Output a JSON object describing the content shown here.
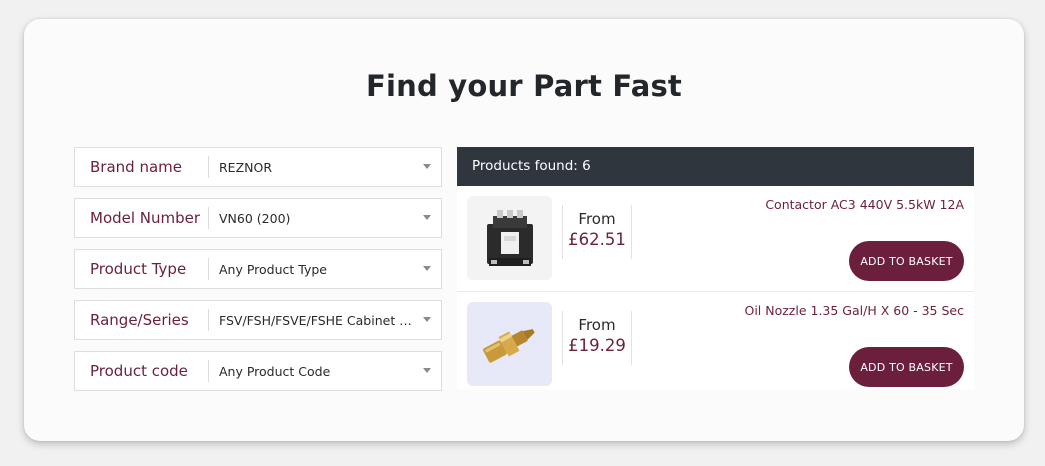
{
  "title": "Find your Part Fast",
  "filters": [
    {
      "label": "Brand name",
      "value": "REZNOR"
    },
    {
      "label": "Model Number",
      "value": "VN60 (200)"
    },
    {
      "label": "Product Type",
      "value": "Any Product Type"
    },
    {
      "label": "Range/Series",
      "value": "FSV/FSH/FSVE/FSHE Cabinet He..."
    },
    {
      "label": "Product code",
      "value": "Any Product Code"
    }
  ],
  "results": {
    "header": "Products found: 6",
    "products": [
      {
        "name": "Contactor AC3 440V 5.5kW 12A",
        "from_label": "From",
        "price": "£62.51",
        "button": "ADD TO BASKET",
        "image": "contactor-image"
      },
      {
        "name": "Oil Nozzle 1.35 Gal/H X 60 - 35 Sec",
        "from_label": "From",
        "price": "£19.29",
        "button": "ADD TO BASKET",
        "image": "oil-nozzle-image"
      }
    ]
  },
  "colors": {
    "brand": "#6b1f3c",
    "header_bg": "#30363d",
    "card_bg": "#fbfbfb"
  }
}
